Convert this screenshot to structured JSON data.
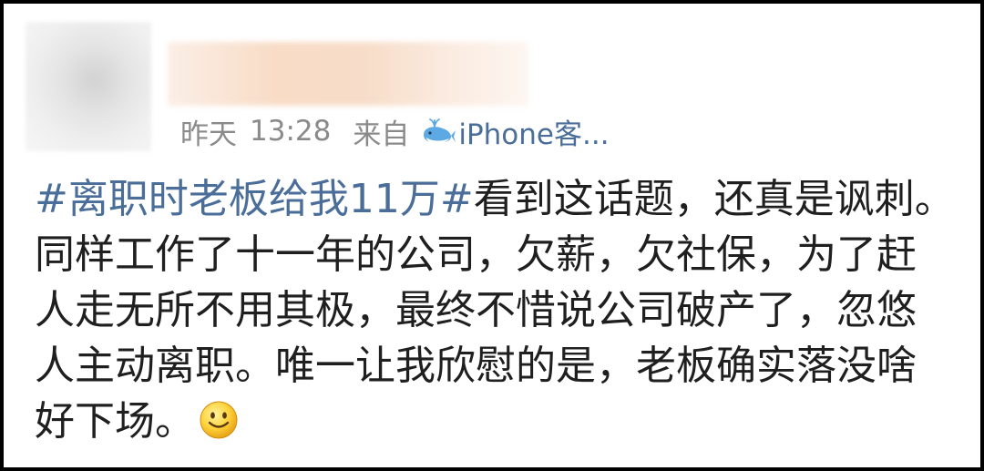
{
  "post": {
    "time_day": "昨天",
    "time_clock": "13:28",
    "source_prefix": "来自",
    "source_client": "iPhone客...",
    "source_icon": "whale-icon",
    "topic": "#离职时老板给我11万#",
    "body": "看到这话题，还真是讽刺。同样工作了十一年的公司，欠薪，欠社保，为了赶人走无所不用其极，最终不惜说公司破产了，忽悠人主动离职。唯一让我欣慰的是，老板确实落没啥好下场。",
    "emoji": "smiley-emoji"
  },
  "colors": {
    "topic_link": "#4a6e99",
    "meta_text": "#8a8a8a",
    "body_text": "#1f1f1f",
    "border": "#000000"
  }
}
